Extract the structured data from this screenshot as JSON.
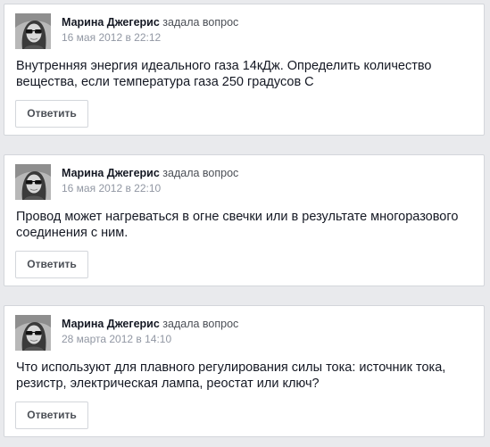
{
  "feed": {
    "posts": [
      {
        "author": "Марина Джегерис",
        "action": "задала вопрос",
        "timestamp": "16 мая 2012 в 22:12",
        "question": "Внутренняя энергия идеального газа 14кДж. Определить количество вещества, если температура газа 250 градусов С",
        "answer_label": "Ответить"
      },
      {
        "author": "Марина Джегерис",
        "action": "задала вопрос",
        "timestamp": "16 мая 2012 в 22:10",
        "question": "Провод может нагреваться в огне свечки или в результате многоразового соединения с ним.",
        "answer_label": "Ответить"
      },
      {
        "author": "Марина Джегерис",
        "action": "задала вопрос",
        "timestamp": "28 марта 2012 в 14:10",
        "question": "Что используют для плавного регулирования силы тока: источник тока, резистр, электрическая лампа, реостат или ключ?",
        "answer_label": "Ответить"
      }
    ]
  },
  "colors": {
    "background": "#e9eaed",
    "card": "#ffffff",
    "border": "#d3d6db",
    "author": "#141823",
    "timestamp": "#9197a3"
  }
}
